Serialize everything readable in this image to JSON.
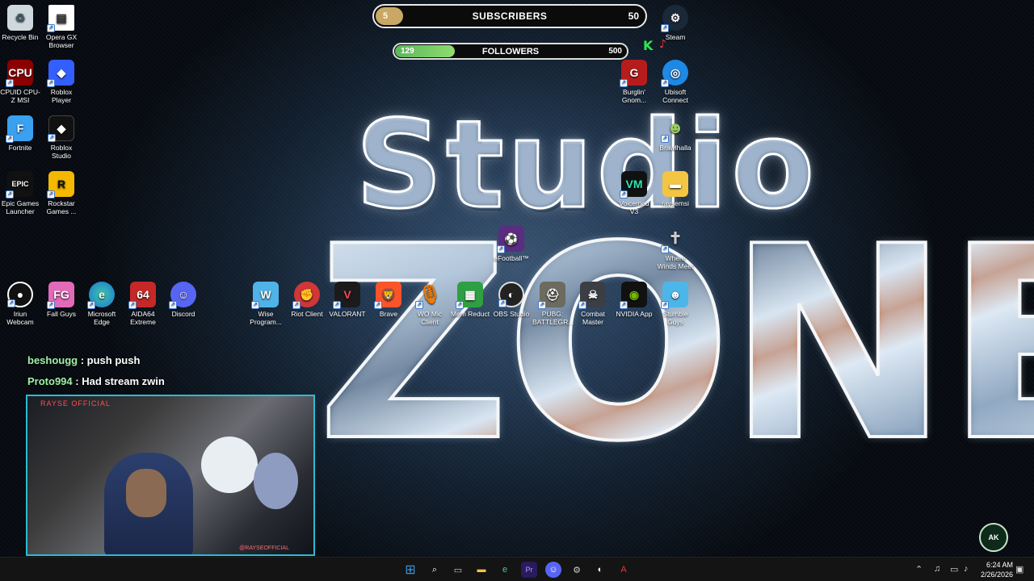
{
  "overlay": {
    "subscribers": {
      "label": "SUBSCRIBERS",
      "current": "5",
      "goal": "50",
      "progress": 0.1
    },
    "followers": {
      "label": "FOLLOWERS",
      "current": "129",
      "goal": "500",
      "progress": 0.258
    }
  },
  "wallpaper": {
    "line1": "Studio",
    "line2": "ZONE"
  },
  "desktop_icons": {
    "recycle_bin": "Recycle Bin",
    "opera_gx": "Opera GX Browser",
    "cpuid": "CPUID CPU-Z MSI",
    "roblox_player": "Roblox Player",
    "fortnite": "Fortnite",
    "roblox_studio": "Roblox Studio",
    "epic": "Epic Games Launcher",
    "rockstar": "Rockstar Games ...",
    "iriun": "Iriun Webcam",
    "fall_guys": "Fall Guys",
    "edge": "Microsoft Edge",
    "aida64": "AIDA64 Extreme",
    "discord": "Discord",
    "wise": "Wise Program...",
    "riot": "Riot Client",
    "valorant": "VALORANT",
    "brave": "Brave",
    "wo_mic": "WO Mic Client",
    "mem_reduct": "Mem Reduct",
    "obs": "OBS Studio",
    "pubg": "PUBG: BATTLEGR...",
    "combat_master": "Combat Master",
    "nvidia": "NVIDIA App",
    "stumble": "Stumble Guys",
    "efootball": "eFootball™",
    "where_winds": "Where Winds Meet",
    "voicemod": "Voicemod V3",
    "raysemsi": "raysemsi",
    "brawlhalla": "Brawlhalla",
    "burglin": "Burglin' Gnom...",
    "ubisoft": "Ubisoft Connect",
    "steam": "Steam"
  },
  "chat": [
    {
      "user": "beshougg",
      "message": "push push"
    },
    {
      "user": "Proto994",
      "message": "Had stream zwin"
    }
  ],
  "webcam": {
    "label": "RAYSE OFFICIAL",
    "handle": "@RAYSEOFFICIAL"
  },
  "taskbar": {
    "time": "6:24 AM",
    "date": "2/26/2026"
  },
  "badge": "AK",
  "colors": {
    "accent_green": "#5ab65a",
    "sub_fill": "#c9a865",
    "cam_border": "#2bbcd4"
  }
}
